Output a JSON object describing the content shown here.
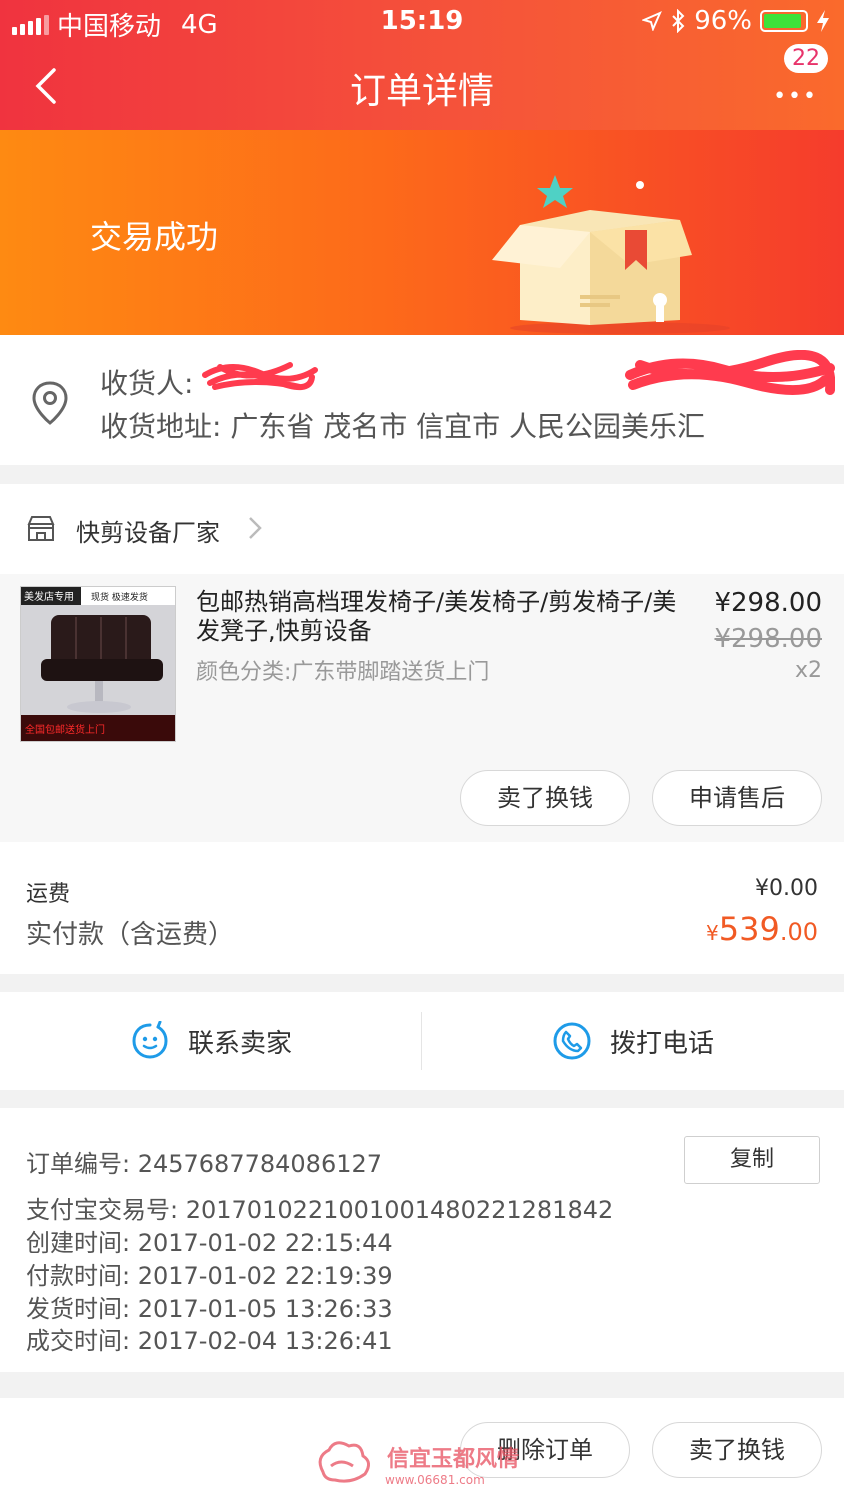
{
  "status_bar": {
    "carrier": "中国移动",
    "network": "4G",
    "time": "15:19",
    "battery": "96%"
  },
  "header": {
    "title": "订单详情",
    "badge": "22"
  },
  "banner": {
    "status": "交易成功"
  },
  "address": {
    "recipient_label": "收货人:",
    "address_label": "收货地址:",
    "address_value": "广东省 茂名市 信宜市 人民公园美乐汇"
  },
  "shop": {
    "name": "快剪设备厂家"
  },
  "item": {
    "title": "包邮热销高档理发椅子/美发椅子/剪发椅子/美发凳子,快剪设备",
    "spec": "颜色分类:广东带脚踏送货上门",
    "price": "¥298.00",
    "original_price": "¥298.00",
    "quantity": "x2",
    "thumb_tag": "美发店专用",
    "thumb_tag2": "现货 极速发货",
    "thumb_bottom": "全国包邮送货上门",
    "button_sell": "卖了换钱",
    "button_aftersale": "申请售后"
  },
  "fees": {
    "shipping_label": "运费",
    "shipping_value": "¥0.00",
    "paid_label": "实付款（含运费）",
    "paid_currency": "¥",
    "paid_int": "539",
    "paid_dec": ".00"
  },
  "contact": {
    "seller": "联系卖家",
    "call": "拨打电话"
  },
  "order_info": {
    "order_no": "订单编号:  2457687784086127",
    "alipay_no": "支付宝交易号:  2017010221001001480221281842",
    "created": "创建时间:  2017-01-02 22:15:44",
    "paid": "付款时间:  2017-01-02 22:19:39",
    "shipped": "发货时间:  2017-01-05 13:26:33",
    "closed": "成交时间:  2017-02-04 13:26:41",
    "copy_label": "复制"
  },
  "bottom": {
    "delete": "删除订单",
    "sell": "卖了换钱"
  },
  "watermark": {
    "text": "信宜玉都风情",
    "url": "www.06681.com"
  },
  "colors": {
    "header_red": "#f0333f",
    "banner_orange": "#fe8a12",
    "price_orange": "#f15a24",
    "contact_blue": "#1e9be8"
  }
}
